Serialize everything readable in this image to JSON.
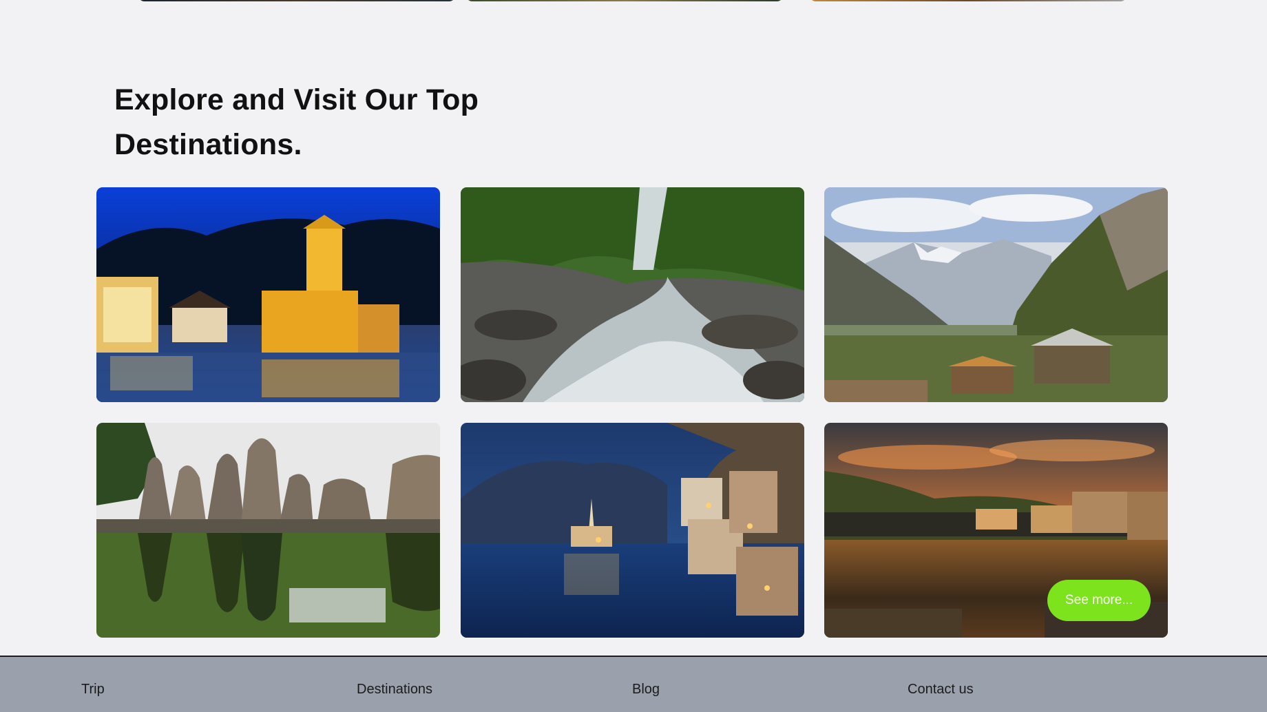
{
  "section": {
    "title": "Explore and Visit Our Top Destinations."
  },
  "destinations": [
    {
      "image": "illuminated church square at night"
    },
    {
      "image": "mountain stream flowing over rocks"
    },
    {
      "image": "mountain valley village with snow peaks"
    },
    {
      "image": "rock cut temples reflected in pond"
    },
    {
      "image": "lakeside town at dusk with church spire"
    },
    {
      "image": "lake village at sunset"
    }
  ],
  "see_more_label": "See more...",
  "footer": {
    "links": [
      "Trip",
      "Destinations",
      "Blog",
      "Contact us"
    ]
  },
  "colors": {
    "accent": "#7ce31c",
    "footer_bg": "#9aa1ad",
    "page_bg": "#f2f2f5"
  }
}
